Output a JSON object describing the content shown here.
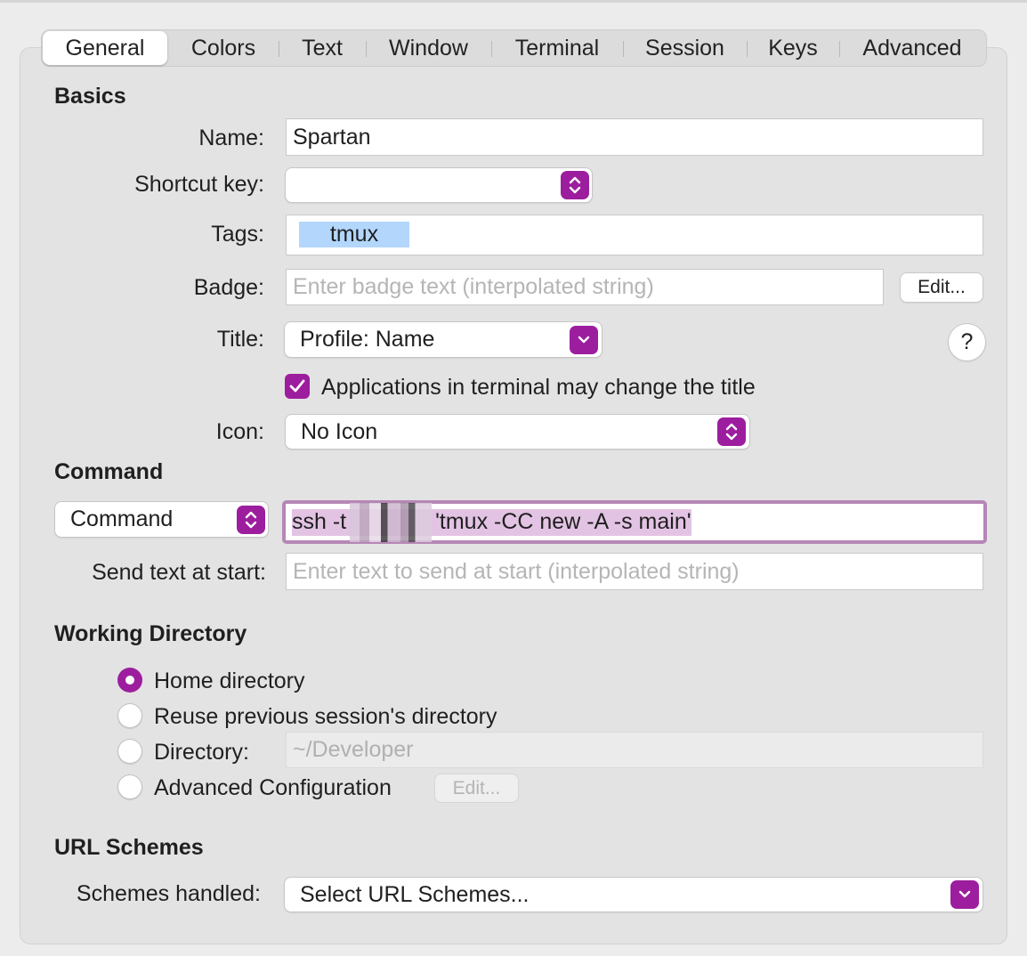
{
  "tabs": [
    "General",
    "Colors",
    "Text",
    "Window",
    "Terminal",
    "Session",
    "Keys",
    "Advanced"
  ],
  "active_tab": "General",
  "basics": {
    "heading": "Basics",
    "name_label": "Name:",
    "name_value": "Spartan",
    "shortcut_label": "Shortcut key:",
    "shortcut_value": "",
    "tags_label": "Tags:",
    "tag": "tmux",
    "badge_label": "Badge:",
    "badge_placeholder": "Enter badge text (interpolated string)",
    "badge_edit": "Edit...",
    "title_label": "Title:",
    "title_value": "Profile: Name",
    "help": "?",
    "apps_change_title_label": "Applications in terminal may change the title",
    "apps_change_title_checked": true,
    "icon_label": "Icon:",
    "icon_value": "No Icon"
  },
  "command": {
    "heading": "Command",
    "mode_value": "Command",
    "command_prefix": "ssh -t",
    "command_suffix": "'tmux -CC new -A -s main'",
    "send_text_label": "Send text at start:",
    "send_text_placeholder": "Enter text to send at start (interpolated string)"
  },
  "working_directory": {
    "heading": "Working Directory",
    "options": [
      {
        "label": "Home directory",
        "selected": true
      },
      {
        "label": "Reuse previous session's directory",
        "selected": false
      },
      {
        "label": "Directory:",
        "selected": false
      },
      {
        "label": "Advanced Configuration",
        "selected": false
      }
    ],
    "directory_value": "~/Developer",
    "advanced_edit": "Edit..."
  },
  "url_schemes": {
    "heading": "URL Schemes",
    "label": "Schemes handled:",
    "value": "Select URL Schemes..."
  },
  "colors": {
    "accent": "#9c1e9e",
    "tag_bg": "#b3d6fd",
    "selection": "#e3c3e4"
  }
}
